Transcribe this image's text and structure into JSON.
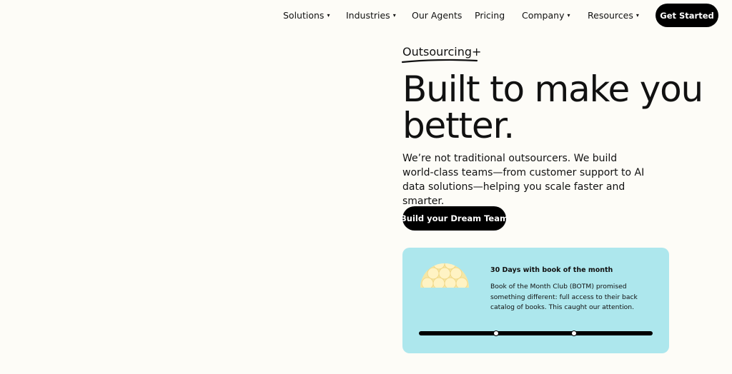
{
  "nav": {
    "items": [
      {
        "label": "Solutions",
        "has_dropdown": true
      },
      {
        "label": "Industries",
        "has_dropdown": true
      },
      {
        "label": "Our Agents",
        "has_dropdown": false
      },
      {
        "label": "Pricing",
        "has_dropdown": false
      },
      {
        "label": "Company",
        "has_dropdown": true
      },
      {
        "label": "Resources",
        "has_dropdown": true
      }
    ],
    "caret": "▾",
    "cta_label": "Get Started"
  },
  "hero": {
    "eyebrow": "Outsourcing+",
    "headline": "Built to make you better.",
    "subtext": "We’re not traditional outsourcers. We build world-class teams—from customer support to AI data solutions—helping you scale faster and smarter.",
    "cta_label": "Build your Dream Team"
  },
  "case_card": {
    "title": "30 Days with book of the month",
    "body": "Book of the Month Club (BOTM) promised something different: full access to their back catalog of books. This caught our attention.",
    "logo_icon": "botm-logo-icon",
    "background_color": "#ade7ed"
  },
  "colors": {
    "page_background": "#fdfcf7",
    "button_background": "#000000",
    "button_text": "#ffffff"
  }
}
